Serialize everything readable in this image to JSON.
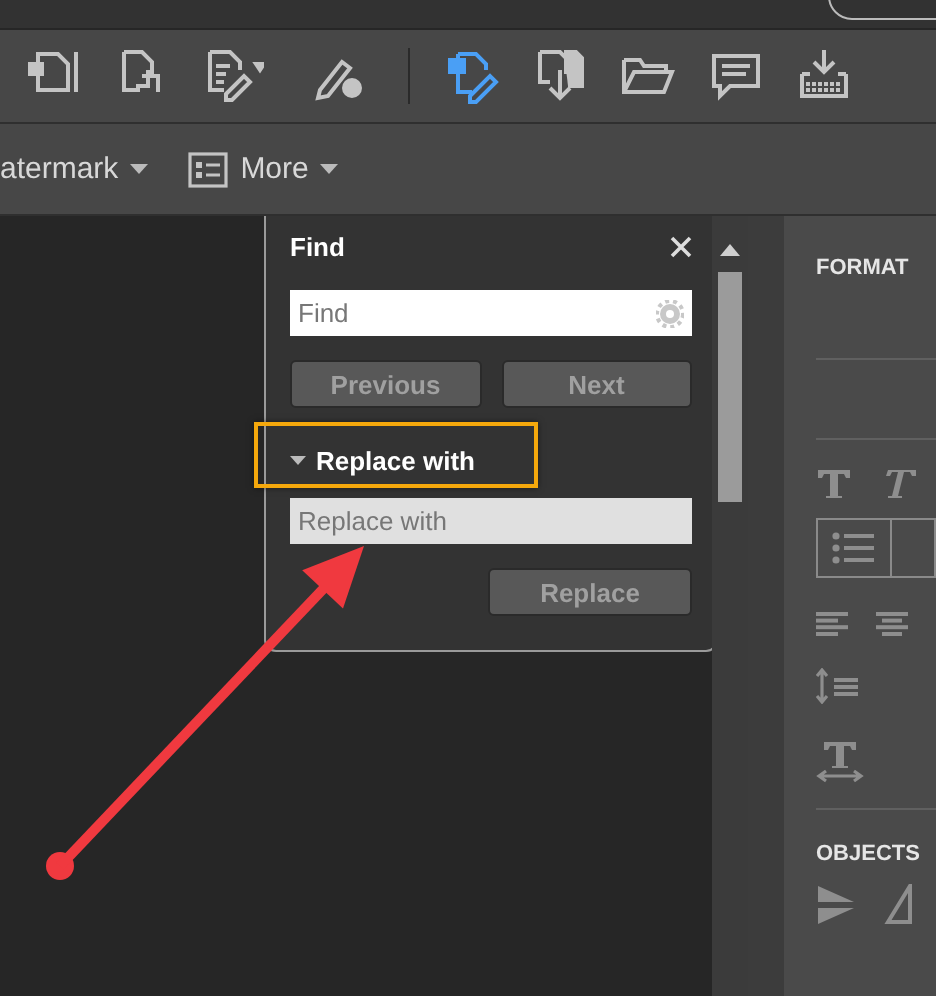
{
  "toolbar": {
    "tools": [
      {
        "kind": "insert",
        "selected": false
      },
      {
        "kind": "crop",
        "selected": false
      },
      {
        "kind": "edit",
        "selected": false
      },
      {
        "kind": "sign",
        "selected": false
      },
      {
        "kind": "editpdf",
        "selected": true
      },
      {
        "kind": "export",
        "selected": false
      },
      {
        "kind": "open",
        "selected": false
      },
      {
        "kind": "comment",
        "selected": false
      },
      {
        "kind": "stamp",
        "selected": false
      }
    ]
  },
  "secondary_bar": {
    "items": [
      {
        "label": "atermark",
        "kind": "plain"
      },
      {
        "label": "More",
        "kind": "list"
      }
    ]
  },
  "find_panel": {
    "title": "Find",
    "find_field": {
      "placeholder": "Find"
    },
    "buttons": [
      {
        "label": "Previous",
        "disabled": true
      },
      {
        "label": "Next",
        "disabled": true
      }
    ],
    "replace_section": {
      "label": "Replace with",
      "expanded": true
    },
    "replace_field": {
      "placeholder": "Replace with"
    },
    "replace_button": {
      "label": "Replace",
      "disabled": true
    }
  },
  "format_panel": {
    "heading": "FORMAT",
    "objects_heading": "OBJECTS"
  }
}
